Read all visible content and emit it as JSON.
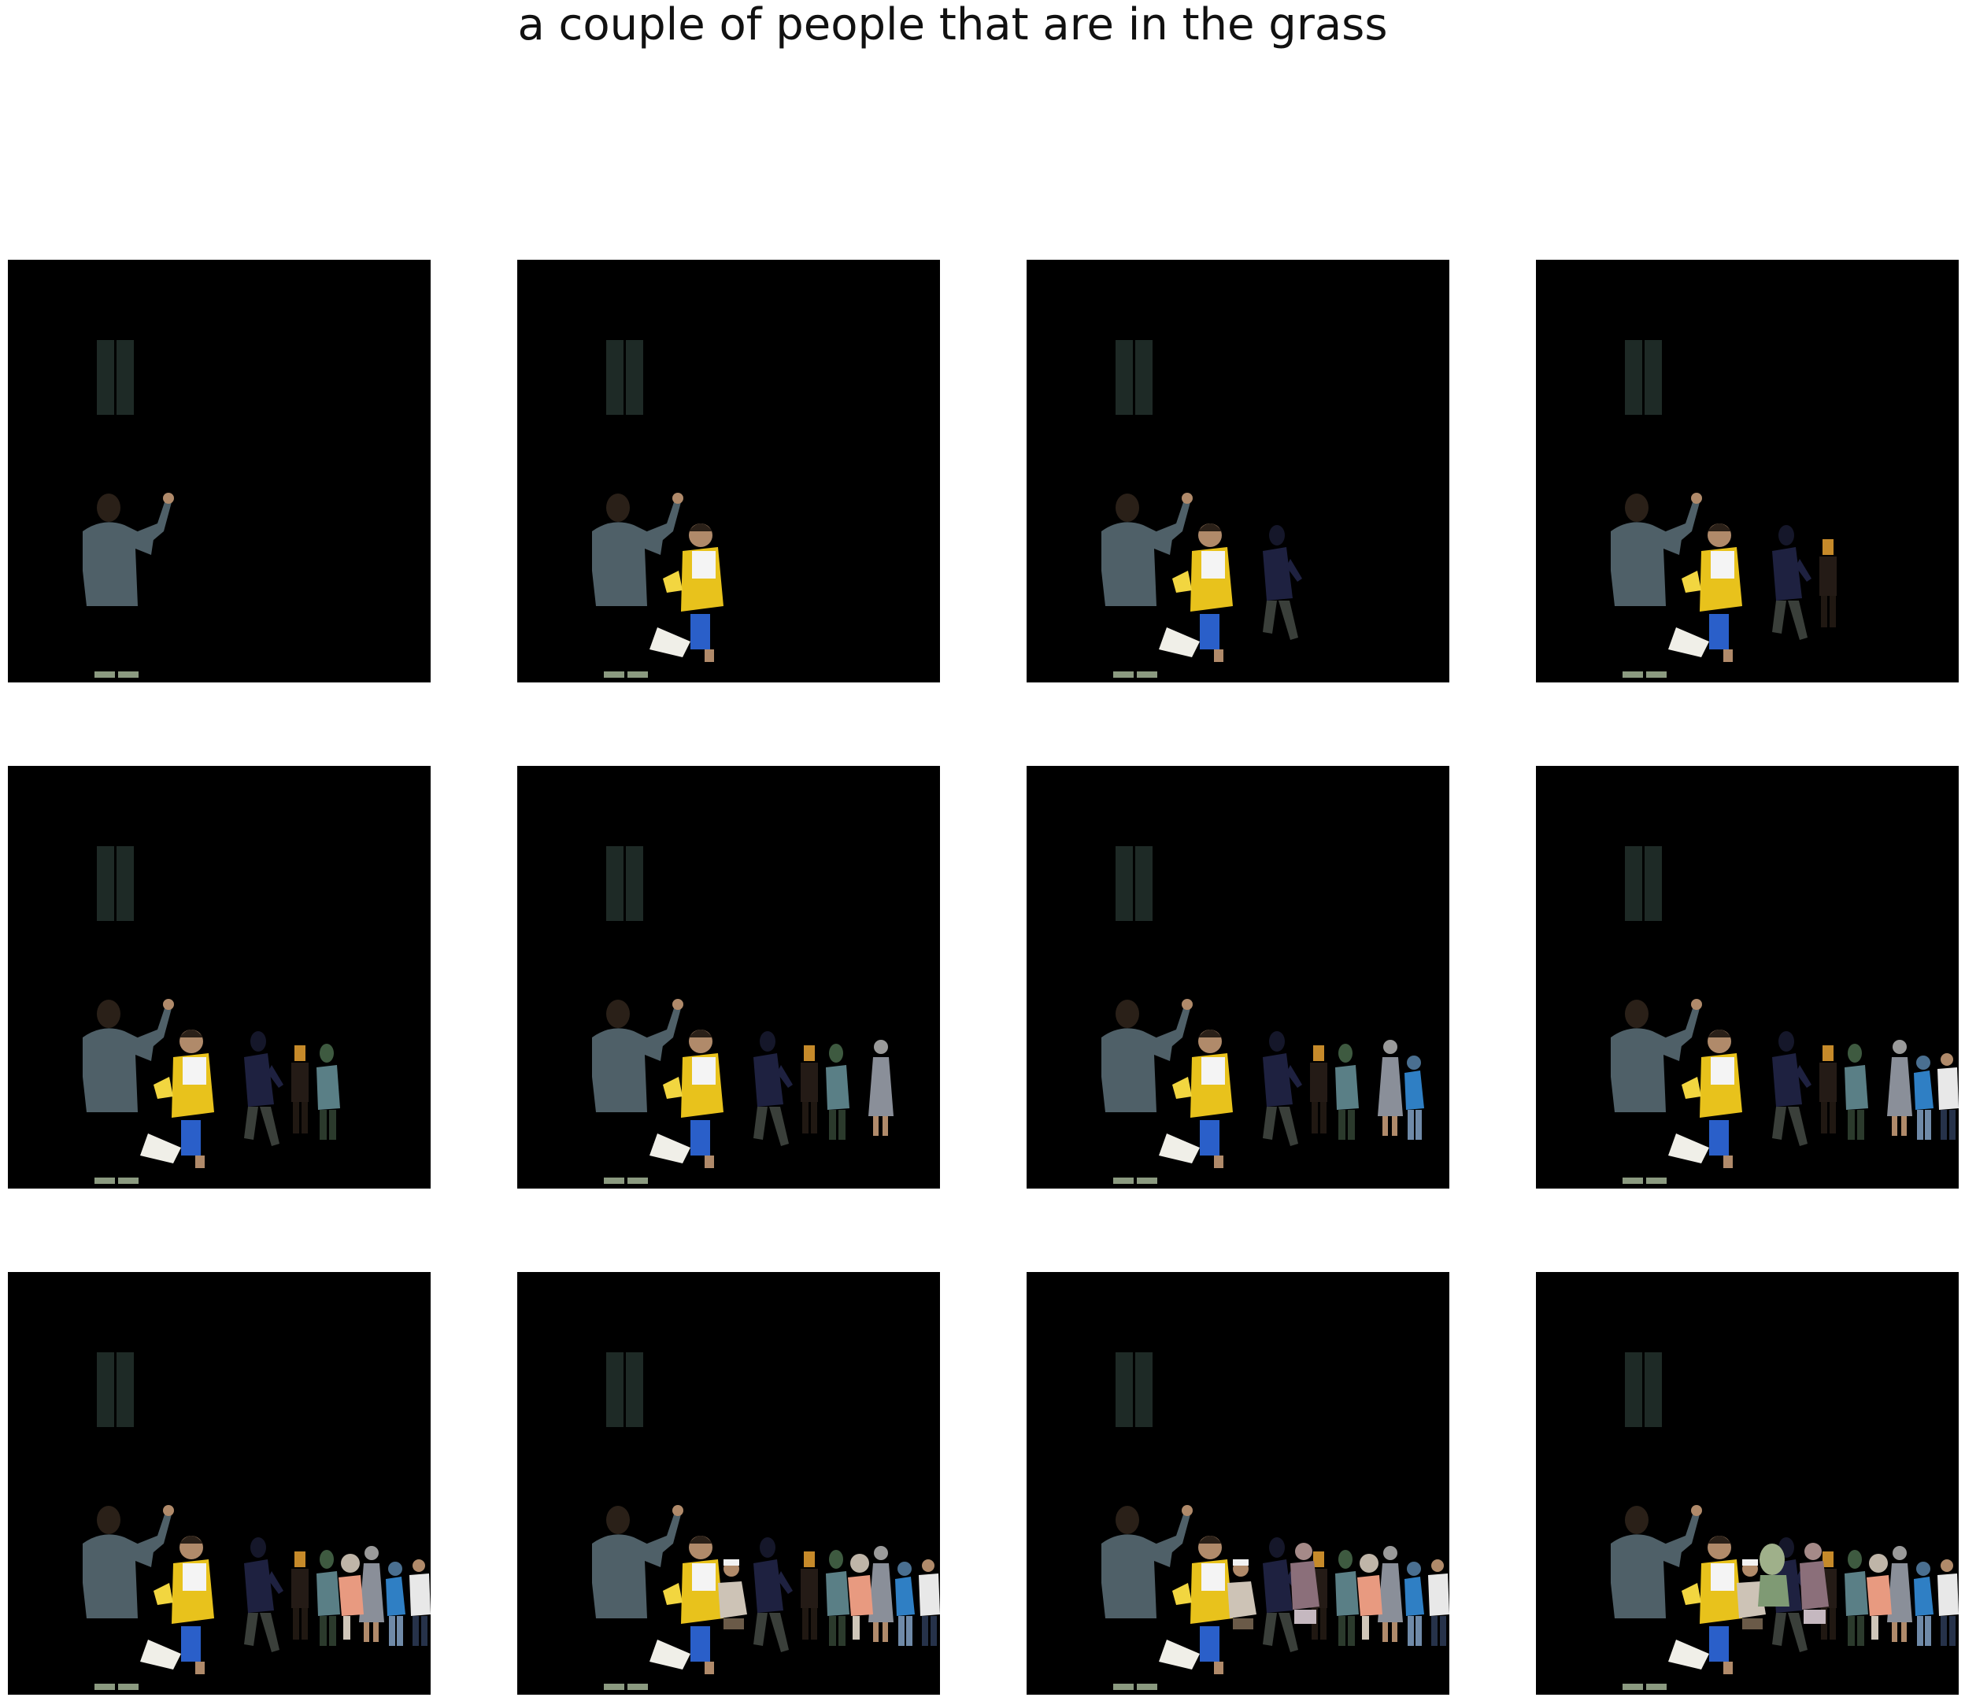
{
  "figure": {
    "title": "a couple of people that are in the grass"
  },
  "panels": [
    {
      "index": 1,
      "figures": [
        "man-waving"
      ]
    },
    {
      "index": 2,
      "figures": [
        "man-waving",
        "child-yellow-shirt"
      ]
    },
    {
      "index": 3,
      "figures": [
        "man-waving",
        "child-yellow-shirt",
        "runner-dark"
      ]
    },
    {
      "index": 4,
      "figures": [
        "man-waving",
        "child-yellow-shirt",
        "runner-dark",
        "small-figure-dark"
      ]
    },
    {
      "index": 5,
      "figures": [
        "man-waving",
        "child-yellow-shirt",
        "runner-dark",
        "small-figure-dark",
        "figure-teal"
      ]
    },
    {
      "index": 6,
      "figures": [
        "man-waving",
        "child-yellow-shirt",
        "runner-dark",
        "small-figure-dark",
        "figure-teal",
        "woman-grey-dress"
      ]
    },
    {
      "index": 7,
      "figures": [
        "man-waving",
        "child-yellow-shirt",
        "runner-dark",
        "small-figure-dark",
        "figure-teal",
        "woman-grey-dress",
        "person-blue"
      ]
    },
    {
      "index": 8,
      "figures": [
        "man-waving",
        "child-yellow-shirt",
        "runner-dark",
        "small-figure-dark",
        "figure-teal",
        "woman-grey-dress",
        "person-blue",
        "person-white-shirt"
      ]
    },
    {
      "index": 9,
      "figures": [
        "man-waving",
        "child-yellow-shirt",
        "runner-dark",
        "small-figure-dark",
        "figure-teal",
        "woman-grey-dress",
        "person-blue",
        "person-white-shirt",
        "woman-pink"
      ]
    },
    {
      "index": 10,
      "figures": [
        "man-waving",
        "child-yellow-shirt",
        "runner-dark",
        "small-figure-dark",
        "figure-teal",
        "woman-grey-dress",
        "person-blue",
        "person-white-shirt",
        "woman-pink",
        "man-white-cap"
      ]
    },
    {
      "index": 11,
      "figures": [
        "man-waving",
        "child-yellow-shirt",
        "runner-dark",
        "small-figure-dark",
        "figure-teal",
        "woman-grey-dress",
        "person-blue",
        "person-white-shirt",
        "woman-pink",
        "man-white-cap",
        "figure-patterned"
      ]
    },
    {
      "index": 12,
      "figures": [
        "man-waving",
        "child-yellow-shirt",
        "runner-dark",
        "small-figure-dark",
        "figure-teal",
        "woman-grey-dress",
        "person-blue",
        "person-white-shirt",
        "woman-pink",
        "man-white-cap",
        "figure-patterned",
        "face-green"
      ]
    }
  ],
  "colors": {
    "background": "#000000",
    "page": "#ffffff",
    "shirt_grey": "#4f6068",
    "pants_dark": "#1e2a26",
    "skin": "#b08a6a",
    "hair": "#2a2018",
    "shirt_yellow": "#e8c21c",
    "shorts_blue": "#2a5fc9",
    "shirt_navy": "#1e2140",
    "teal": "#5a7f86",
    "dress_grey": "#8a8f99",
    "blue_person": "#2f7fc4",
    "white_shirt": "#e8e8e8",
    "pink": "#e89a80",
    "patterned": "#8b6f7a",
    "green_face": "#9fb08a"
  }
}
